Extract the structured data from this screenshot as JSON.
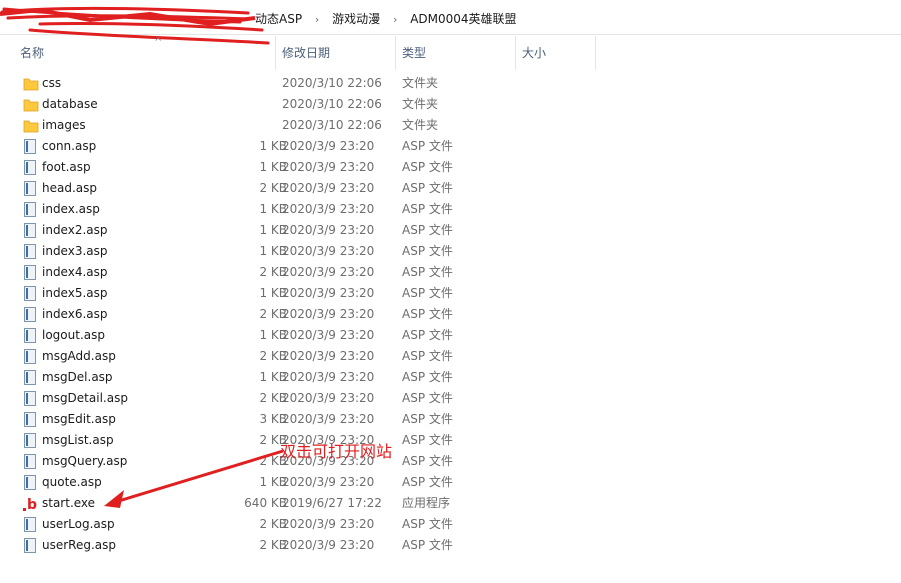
{
  "breadcrumb": {
    "items": [
      "动态ASP",
      "游戏动漫",
      "ADM0004英雄联盟"
    ],
    "separator": "›"
  },
  "columns": {
    "name": "名称",
    "date": "修改日期",
    "type": "类型",
    "size": "大小"
  },
  "files": [
    {
      "name": "css",
      "date": "2020/3/10 22:06",
      "type": "文件夹",
      "size": "",
      "icon": "folder-icon"
    },
    {
      "name": "database",
      "date": "2020/3/10 22:06",
      "type": "文件夹",
      "size": "",
      "icon": "folder-icon"
    },
    {
      "name": "images",
      "date": "2020/3/10 22:06",
      "type": "文件夹",
      "size": "",
      "icon": "folder-icon"
    },
    {
      "name": "conn.asp",
      "date": "2020/3/9 23:20",
      "type": "ASP 文件",
      "size": "1 KB",
      "icon": "asp-file-icon"
    },
    {
      "name": "foot.asp",
      "date": "2020/3/9 23:20",
      "type": "ASP 文件",
      "size": "1 KB",
      "icon": "asp-file-icon"
    },
    {
      "name": "head.asp",
      "date": "2020/3/9 23:20",
      "type": "ASP 文件",
      "size": "2 KB",
      "icon": "asp-file-icon"
    },
    {
      "name": "index.asp",
      "date": "2020/3/9 23:20",
      "type": "ASP 文件",
      "size": "1 KB",
      "icon": "asp-file-icon"
    },
    {
      "name": "index2.asp",
      "date": "2020/3/9 23:20",
      "type": "ASP 文件",
      "size": "1 KB",
      "icon": "asp-file-icon"
    },
    {
      "name": "index3.asp",
      "date": "2020/3/9 23:20",
      "type": "ASP 文件",
      "size": "1 KB",
      "icon": "asp-file-icon"
    },
    {
      "name": "index4.asp",
      "date": "2020/3/9 23:20",
      "type": "ASP 文件",
      "size": "2 KB",
      "icon": "asp-file-icon"
    },
    {
      "name": "index5.asp",
      "date": "2020/3/9 23:20",
      "type": "ASP 文件",
      "size": "1 KB",
      "icon": "asp-file-icon"
    },
    {
      "name": "index6.asp",
      "date": "2020/3/9 23:20",
      "type": "ASP 文件",
      "size": "2 KB",
      "icon": "asp-file-icon"
    },
    {
      "name": "logout.asp",
      "date": "2020/3/9 23:20",
      "type": "ASP 文件",
      "size": "1 KB",
      "icon": "asp-file-icon"
    },
    {
      "name": "msgAdd.asp",
      "date": "2020/3/9 23:20",
      "type": "ASP 文件",
      "size": "2 KB",
      "icon": "asp-file-icon"
    },
    {
      "name": "msgDel.asp",
      "date": "2020/3/9 23:20",
      "type": "ASP 文件",
      "size": "1 KB",
      "icon": "asp-file-icon"
    },
    {
      "name": "msgDetail.asp",
      "date": "2020/3/9 23:20",
      "type": "ASP 文件",
      "size": "2 KB",
      "icon": "asp-file-icon"
    },
    {
      "name": "msgEdit.asp",
      "date": "2020/3/9 23:20",
      "type": "ASP 文件",
      "size": "3 KB",
      "icon": "asp-file-icon"
    },
    {
      "name": "msgList.asp",
      "date": "2020/3/9 23:20",
      "type": "ASP 文件",
      "size": "2 KB",
      "icon": "asp-file-icon"
    },
    {
      "name": "msgQuery.asp",
      "date": "2020/3/9 23:20",
      "type": "ASP 文件",
      "size": "2 KB",
      "icon": "asp-file-icon"
    },
    {
      "name": "quote.asp",
      "date": "2020/3/9 23:20",
      "type": "ASP 文件",
      "size": "1 KB",
      "icon": "asp-file-icon"
    },
    {
      "name": "start.exe",
      "date": "2019/6/27 17:22",
      "type": "应用程序",
      "size": "640 KB",
      "icon": "exe-app-icon"
    },
    {
      "name": "userLog.asp",
      "date": "2020/3/9 23:20",
      "type": "ASP 文件",
      "size": "2 KB",
      "icon": "asp-file-icon"
    },
    {
      "name": "userReg.asp",
      "date": "2020/3/9 23:20",
      "type": "ASP 文件",
      "size": "2 KB",
      "icon": "asp-file-icon"
    }
  ],
  "annotation": {
    "text": "双击可打开网站",
    "color": "#e02020"
  },
  "colors": {
    "folder": "#ffc83d",
    "header_text": "#4c607a",
    "annotation": "#e02020"
  }
}
